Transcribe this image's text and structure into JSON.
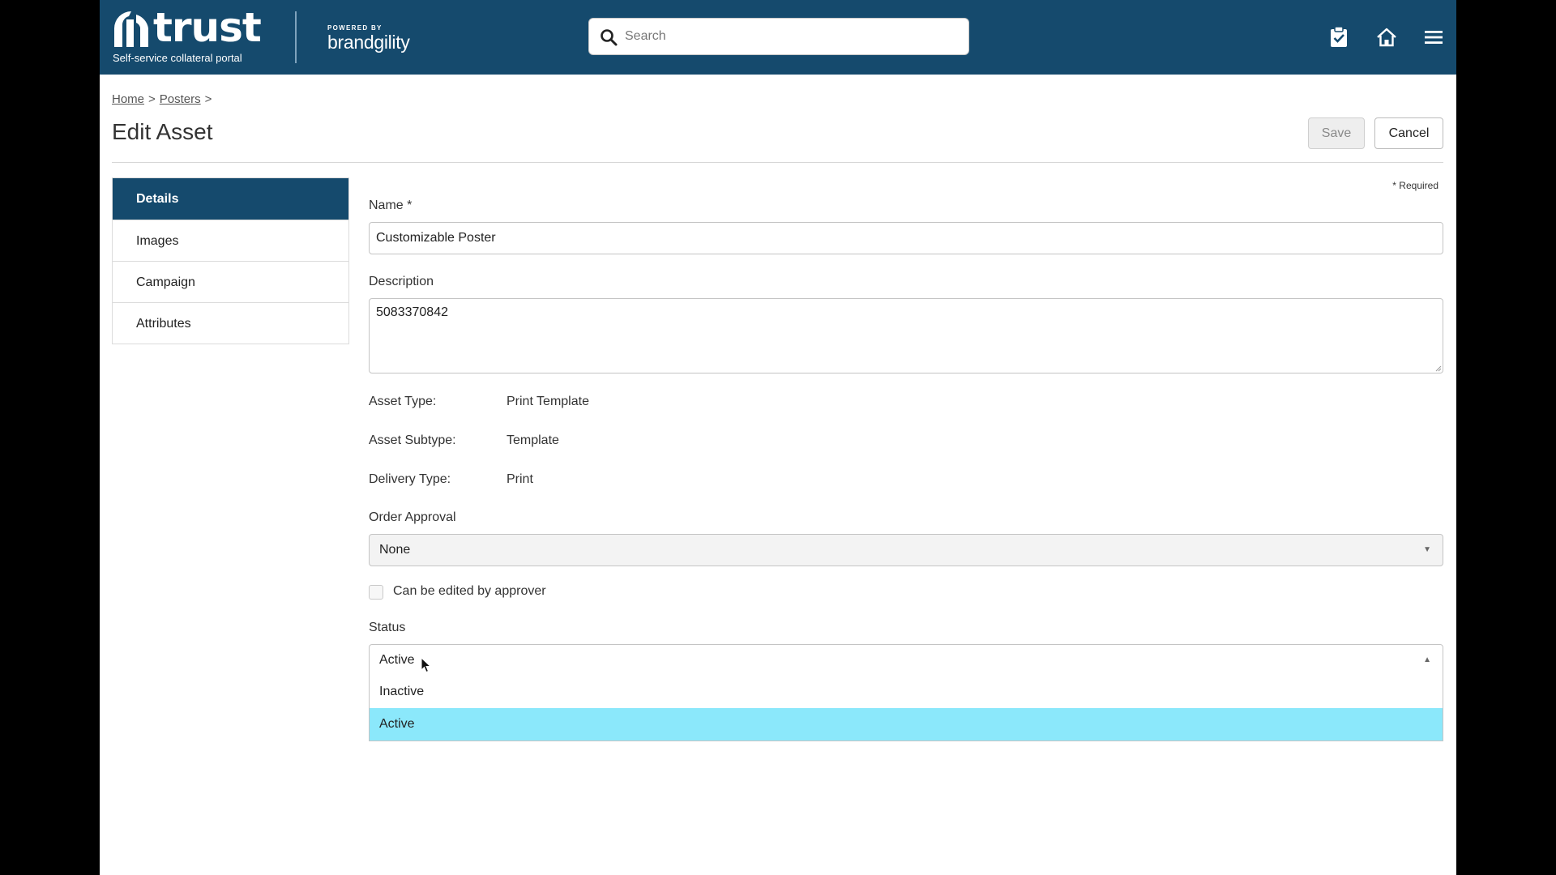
{
  "header": {
    "logo_word": "trust",
    "tagline": "Self-service collateral portal",
    "powered_by": "POWERED BY",
    "powered_brand": "brandgility",
    "search_placeholder": "Search",
    "colors": {
      "brand": "#154a6d"
    }
  },
  "breadcrumb": {
    "home": "Home",
    "section": "Posters",
    "sep": ">"
  },
  "page": {
    "title": "Edit Asset"
  },
  "actions": {
    "save": "Save",
    "cancel": "Cancel"
  },
  "sidenav": {
    "items": [
      {
        "label": "Details",
        "active": true
      },
      {
        "label": "Images"
      },
      {
        "label": "Campaign"
      },
      {
        "label": "Attributes"
      }
    ]
  },
  "form": {
    "required_note": "* Required",
    "name_label": "Name *",
    "name_value": "Customizable Poster",
    "description_label": "Description",
    "description_value": "5083370842",
    "asset_type_label": "Asset Type:",
    "asset_type_value": "Print Template",
    "asset_subtype_label": "Asset Subtype:",
    "asset_subtype_value": "Template",
    "delivery_type_label": "Delivery Type:",
    "delivery_type_value": "Print",
    "order_approval_label": "Order Approval",
    "order_approval_value": "None",
    "approver_edit_label": "Can be edited by approver",
    "approver_edit_checked": false,
    "status_label": "Status",
    "status_value": "Active",
    "status_options": [
      {
        "label": "Inactive"
      },
      {
        "label": "Active",
        "highlighted": true
      }
    ],
    "colors": {
      "highlight": "#8be8fb"
    }
  }
}
